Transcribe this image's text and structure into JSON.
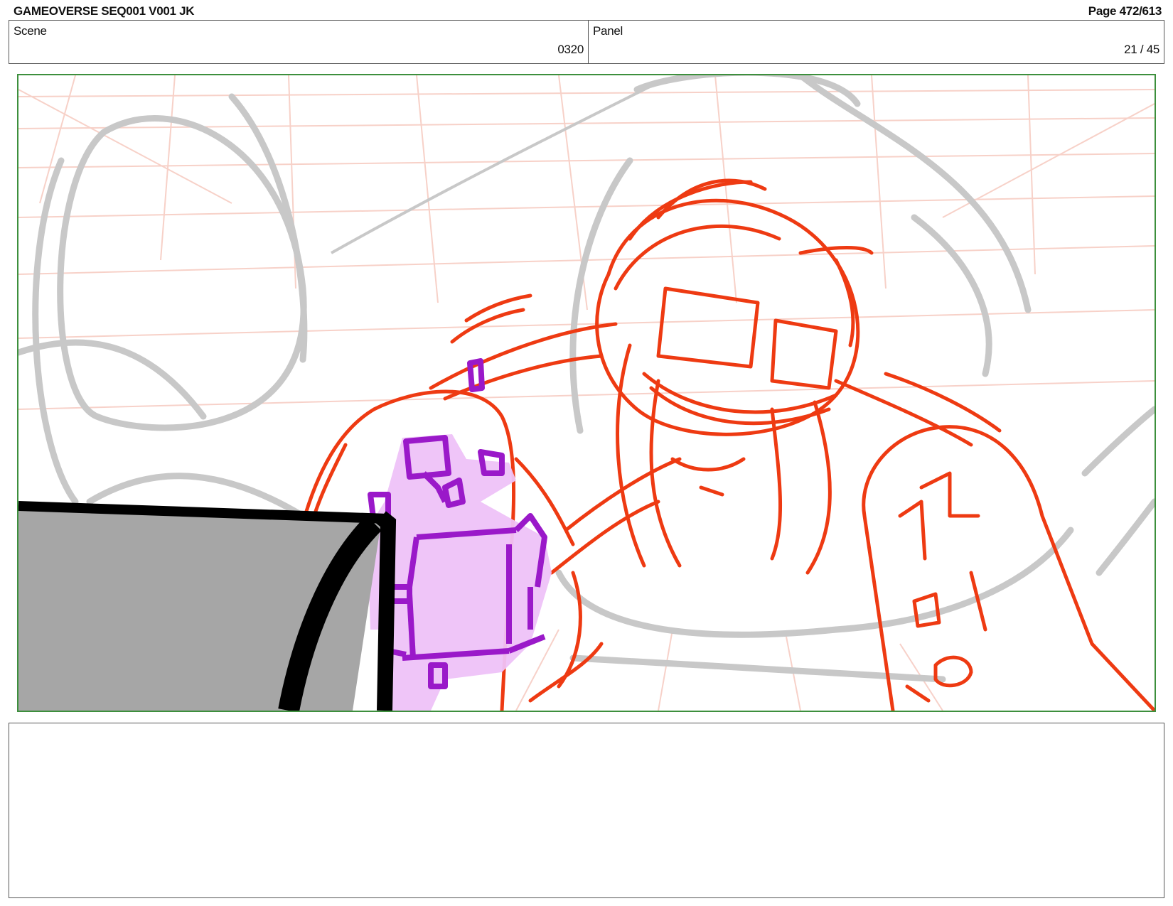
{
  "header": {
    "title": "GAMEOVERSE SEQ001 V001 JK",
    "page": "Page 472/613"
  },
  "info": {
    "scene_label": "Scene",
    "scene_value": "0320",
    "panel_label": "Panel",
    "panel_value": "21 / 45"
  },
  "colors": {
    "frame_border": "#3d8f3d",
    "sketch_red": "#ee3a12",
    "sketch_gray": "#c8c8c8",
    "grid_pink": "#f6c9bf",
    "robot_fill": "#eec2f8",
    "robot_line": "#9a19c9",
    "console_fill": "#a6a6a6",
    "console_line": "#000000"
  }
}
